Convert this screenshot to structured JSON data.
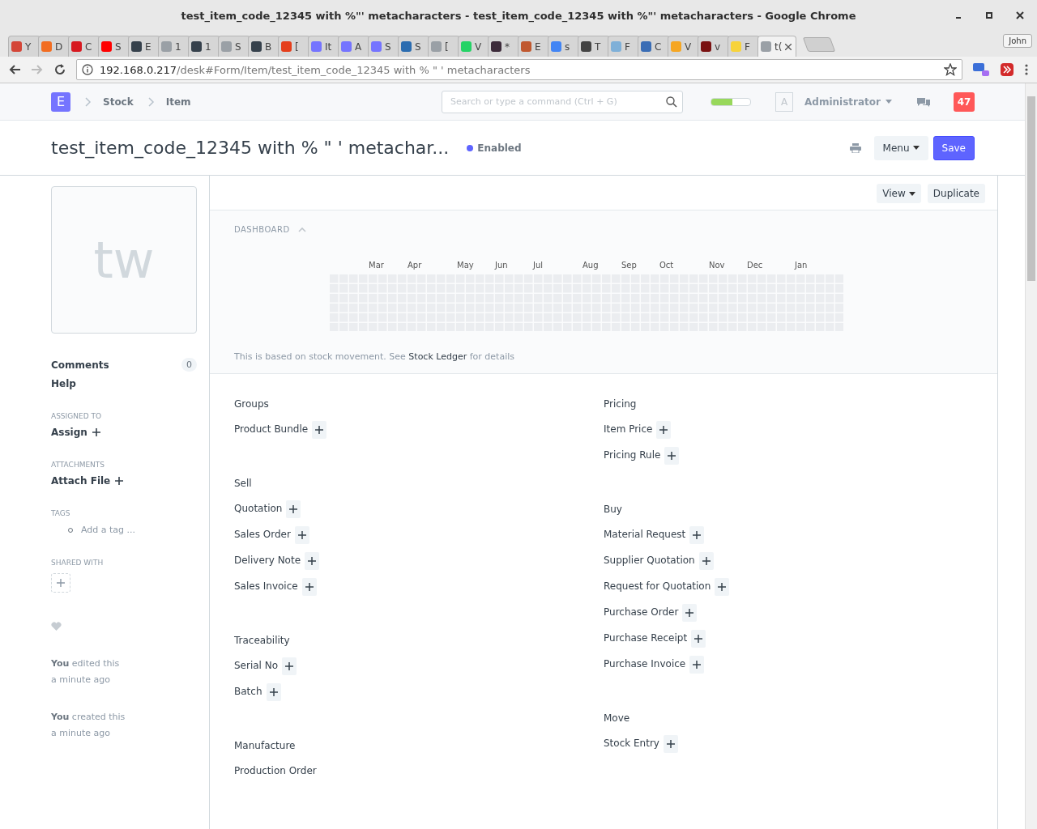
{
  "window": {
    "title": "test_item_code_12345 with %\"' metacharacters - test_item_code_12345 with %\"' metacharacters - Google Chrome",
    "profile": "John"
  },
  "tabs": [
    {
      "label": "Y",
      "color": "#d44638",
      "selected": false
    },
    {
      "label": "D",
      "color": "#f26d21",
      "selected": false
    },
    {
      "label": "C",
      "color": "#d71920",
      "selected": false
    },
    {
      "label": "S",
      "color": "#ff0000",
      "selected": false
    },
    {
      "label": "E",
      "color": "#36414c",
      "selected": false
    },
    {
      "label": "1",
      "color": "#9aa0a6",
      "selected": false
    },
    {
      "label": "1",
      "color": "#36414c",
      "selected": false
    },
    {
      "label": "S",
      "color": "#9aa0a6",
      "selected": false
    },
    {
      "label": "B",
      "color": "#36414c",
      "selected": false
    },
    {
      "label": "[",
      "color": "#e53e1b",
      "selected": false
    },
    {
      "label": "It",
      "color": "#7574ff",
      "selected": false
    },
    {
      "label": "A",
      "color": "#7574ff",
      "selected": false
    },
    {
      "label": "S",
      "color": "#7574ff",
      "selected": false
    },
    {
      "label": "S",
      "color": "#2b6cb0",
      "selected": false
    },
    {
      "label": "[",
      "color": "#9aa0a6",
      "selected": false
    },
    {
      "label": "V",
      "color": "#25d366",
      "selected": false
    },
    {
      "label": "*",
      "color": "#3c2b3a",
      "selected": false
    },
    {
      "label": "E",
      "color": "#c0582f",
      "selected": false
    },
    {
      "label": "s",
      "color": "#4285f4",
      "selected": false
    },
    {
      "label": "T",
      "color": "#444444",
      "selected": false
    },
    {
      "label": "F",
      "color": "#7fb0d8",
      "selected": false
    },
    {
      "label": "C",
      "color": "#3a6db5",
      "selected": false
    },
    {
      "label": "V",
      "color": "#f5a623",
      "selected": false
    },
    {
      "label": "v",
      "color": "#7a1212",
      "selected": false
    },
    {
      "label": "F",
      "color": "#f7d33b",
      "selected": false
    },
    {
      "label": "t(",
      "color": "#9aa0a6",
      "selected": true
    }
  ],
  "address": {
    "host": "192.168.0.217",
    "path": "/desk#Form/Item/test_item_code_12345 with % \" ' metacharacters"
  },
  "navbar": {
    "logo": "E",
    "breadcrumbs": [
      "Stock",
      "Item"
    ],
    "search": {
      "placeholder": "Search or type a command (Ctrl + G)"
    },
    "progress": {
      "level": 0.55
    },
    "avatar": "A",
    "user": "Administrator",
    "notifications": "47"
  },
  "page": {
    "title": "test_item_code_12345 with % \" ' metachar...",
    "status": "Enabled",
    "menu": "Menu",
    "save": "Save"
  },
  "sidebar": {
    "avatar": "tw",
    "comments": {
      "label": "Comments",
      "count": "0"
    },
    "help": "Help",
    "sections": [
      {
        "heading": "ASSIGNED TO",
        "action": "Assign"
      },
      {
        "heading": "ATTACHMENTS",
        "action": "Attach File"
      }
    ],
    "tags": {
      "heading": "TAGS",
      "placeholder": "Add a tag ..."
    },
    "shared": {
      "heading": "SHARED WITH"
    },
    "activity": [
      {
        "text": "**You** edited this",
        "time": "a minute ago"
      },
      {
        "text": "**You** created this",
        "time": "a minute ago"
      }
    ]
  },
  "form": {
    "buttons": [
      "View",
      "Duplicate"
    ],
    "dashboard": {
      "heading": "DASHBOARD",
      "months": [
        "Mar",
        "Apr",
        "May",
        "Jun",
        "Jul",
        "Aug",
        "Sep",
        "Oct",
        "Nov",
        "Dec",
        "Jan"
      ],
      "note": "This is based on stock movement. See",
      "link": "Stock Ledger",
      "note_end": "for details"
    },
    "columns": [
      [
        {
          "title": "Groups",
          "items": [
            {
              "label": "Product Bundle",
              "add": true
            }
          ]
        },
        {
          "title": "Sell",
          "items": [
            {
              "label": "Quotation",
              "add": true
            },
            {
              "label": "Sales Order",
              "add": true
            },
            {
              "label": "Delivery Note",
              "add": true
            },
            {
              "label": "Sales Invoice",
              "add": true
            }
          ]
        },
        {
          "title": "Traceability",
          "items": [
            {
              "label": "Serial No",
              "add": true
            },
            {
              "label": "Batch",
              "add": true
            }
          ]
        },
        {
          "title": "Manufacture",
          "items": [
            {
              "label": "Production Order",
              "add": false
            }
          ]
        }
      ],
      [
        {
          "title": "Pricing",
          "items": [
            {
              "label": "Item Price",
              "add": true
            },
            {
              "label": "Pricing Rule",
              "add": true
            }
          ]
        },
        {
          "title": "Buy",
          "items": [
            {
              "label": "Material Request",
              "add": true
            },
            {
              "label": "Supplier Quotation",
              "add": true
            },
            {
              "label": "Request for Quotation",
              "add": true
            },
            {
              "label": "Purchase Order",
              "add": true
            },
            {
              "label": "Purchase Receipt",
              "add": true
            },
            {
              "label": "Purchase Invoice",
              "add": true
            }
          ]
        },
        {
          "title": "Move",
          "items": [
            {
              "label": "Stock Entry",
              "add": true
            }
          ]
        }
      ]
    ]
  }
}
